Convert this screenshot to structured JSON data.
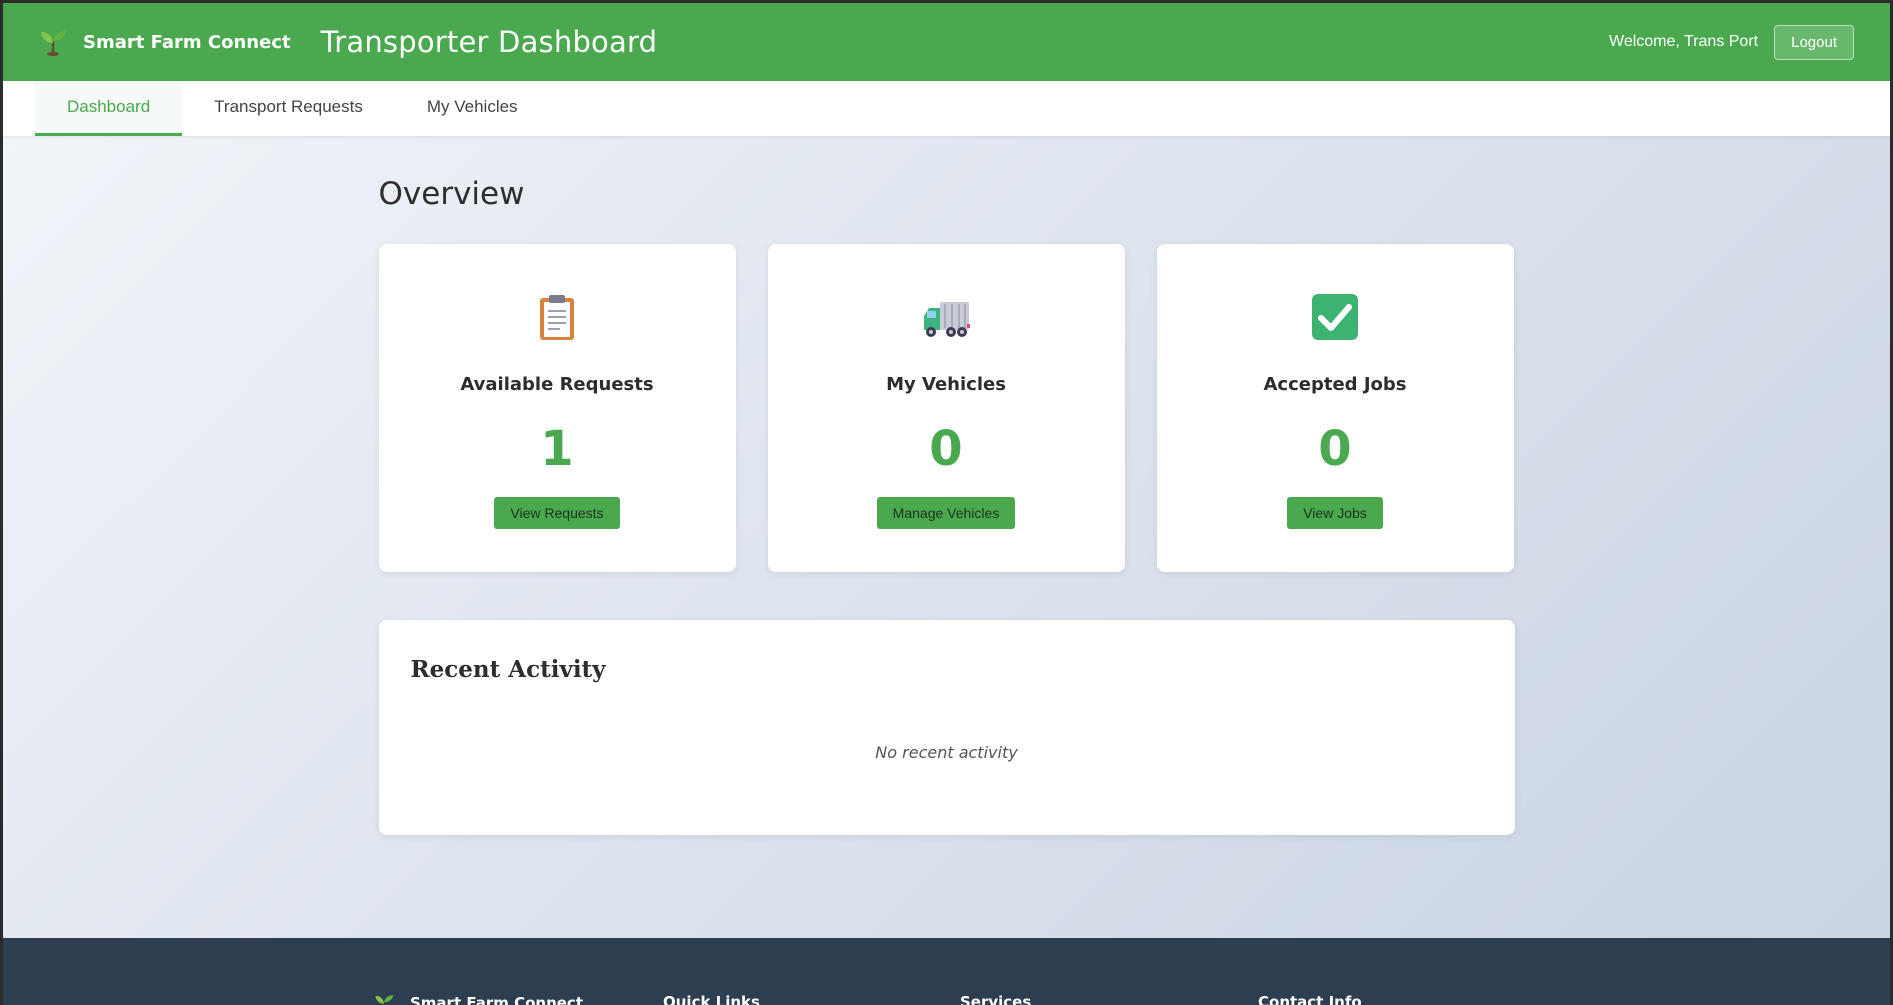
{
  "header": {
    "brand_name": "Smart Farm Connect",
    "page_title": "Transporter Dashboard",
    "welcome": "Welcome, Trans Port",
    "logout_label": "Logout"
  },
  "tabs": [
    {
      "label": "Dashboard",
      "active": true
    },
    {
      "label": "Transport Requests",
      "active": false
    },
    {
      "label": "My Vehicles",
      "active": false
    }
  ],
  "main": {
    "overview_title": "Overview",
    "cards": [
      {
        "icon": "clipboard-icon",
        "title": "Available Requests",
        "value": "1",
        "button": "View Requests"
      },
      {
        "icon": "truck-icon",
        "title": "My Vehicles",
        "value": "0",
        "button": "Manage Vehicles"
      },
      {
        "icon": "check-mark-icon",
        "title": "Accepted Jobs",
        "value": "0",
        "button": "View Jobs"
      }
    ],
    "activity": {
      "title": "Recent Activity",
      "empty_text": "No recent activity"
    }
  },
  "footer": {
    "brand_name": "Smart Farm Connect",
    "quick_links": "Quick Links",
    "services": "Services",
    "contact_info": "Contact Info"
  },
  "colors": {
    "brand_green": "#4aa94e",
    "footer_bg": "#2c3e50"
  }
}
